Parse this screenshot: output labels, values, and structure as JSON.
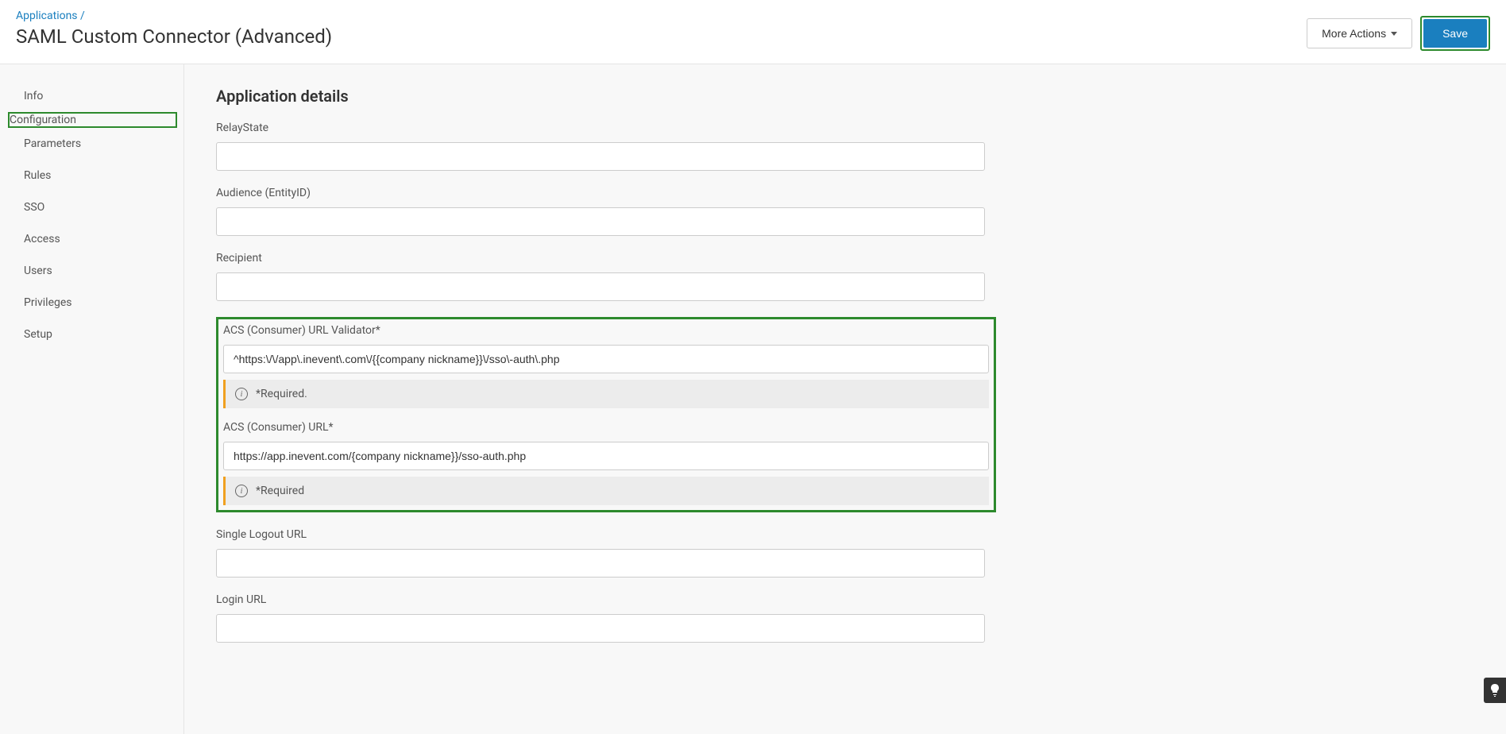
{
  "header": {
    "breadcrumb_parent": "Applications",
    "breadcrumb_sep": "/",
    "title": "SAML Custom Connector (Advanced)",
    "more_actions_label": "More Actions",
    "save_label": "Save"
  },
  "sidebar": {
    "items": [
      {
        "label": "Info"
      },
      {
        "label": "Configuration"
      },
      {
        "label": "Parameters"
      },
      {
        "label": "Rules"
      },
      {
        "label": "SSO"
      },
      {
        "label": "Access"
      },
      {
        "label": "Users"
      },
      {
        "label": "Privileges"
      },
      {
        "label": "Setup"
      }
    ],
    "active_index": 1
  },
  "section": {
    "title": "Application details"
  },
  "fields": {
    "relaystate": {
      "label": "RelayState",
      "value": ""
    },
    "audience": {
      "label": "Audience (EntityID)",
      "value": ""
    },
    "recipient": {
      "label": "Recipient",
      "value": ""
    },
    "acs_validator": {
      "label": "ACS (Consumer) URL Validator*",
      "value": "^https:\\/\\/app\\.inevent\\.com\\/{{company nickname}}\\/sso\\-auth\\.php",
      "note": "*Required."
    },
    "acs_url": {
      "label": "ACS (Consumer) URL*",
      "value": "https://app.inevent.com/{company nickname}}/sso-auth.php",
      "note": "*Required"
    },
    "slo": {
      "label": "Single Logout URL",
      "value": ""
    },
    "login_url": {
      "label": "Login URL",
      "value": ""
    }
  },
  "help_icon": "💡"
}
